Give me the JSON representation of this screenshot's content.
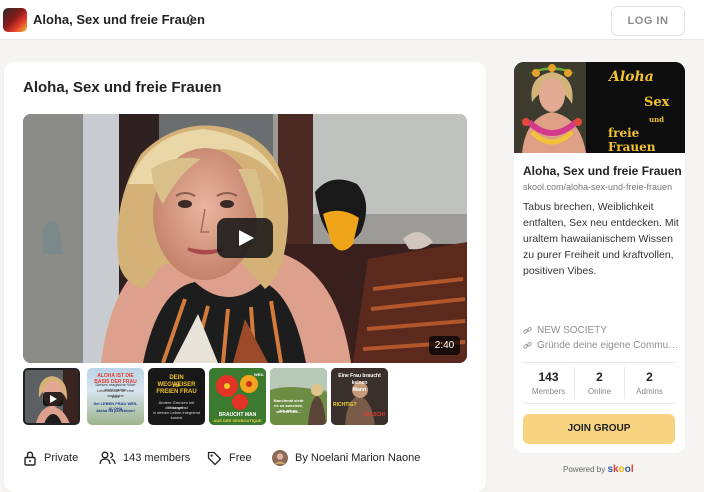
{
  "header": {
    "title": "Aloha, Sex und freie Frauen",
    "login_label": "LOG IN"
  },
  "main": {
    "title": "Aloha, Sex und freie Frauen",
    "video_duration": "2:40",
    "thumbnails": [
      {
        "lines": []
      },
      {
        "lines": [
          "ALOHA IST DIE BASIS DER FRAU",
          "Dieses magische Wort steht meiner",
          "Leidenschaft für eine weibliche",
          "Welt",
          "Sei LEBEN FRAU WEIL ALOHA",
          "Aloha ist perfektion!"
        ]
      },
      {
        "lines": [
          "DEIN WEGWEISER",
          "zur",
          "FREIEN FRAU",
          "Ändere Grenzen mit Übungen",
          "die du selbst",
          "in deinen Leben integrierst kannst"
        ]
      },
      {
        "lines": [
          "BRAUCHT MAN",
          "WEIL",
          "AUS DER SEXBOUTIQUE"
        ]
      },
      {
        "lines": [
          "Manchmal sieht es so aussieht, als wären",
          "wir mit uns..."
        ]
      },
      {
        "lines": [
          "Eine Frau braucht",
          "keinen",
          "Mann",
          "RICHTIG?",
          "FALSCH!"
        ]
      }
    ],
    "meta": {
      "privacy": "Private",
      "members": "143 members",
      "price": "Free",
      "author": "By Noelani Marion Naone"
    }
  },
  "sidebar": {
    "banner_lines": [
      "Aloha",
      "Sex",
      "und",
      "freie Frauen"
    ],
    "name": "Aloha, Sex und freie Frauen",
    "url": "skool.com/aloha-sex-und-freie-frauen",
    "description": "Tabus brechen, Weiblichkeit entfalten, Sex neu entdecken. Mit uraltem hawaiianischem Wissen zu purer Freiheit und kraftvollen, positiven Vibes.",
    "links": [
      "NEW SOCIETY",
      "Gründe deine eigene Commu…"
    ],
    "stats": [
      {
        "value": "143",
        "label": "Members"
      },
      {
        "value": "2",
        "label": "Online"
      },
      {
        "value": "2",
        "label": "Admins"
      }
    ],
    "join_label": "JOIN GROUP"
  },
  "footer": {
    "powered_by": "Powered by",
    "brand": "skool"
  },
  "colors": {
    "join_button": "#f8d481",
    "banner_text": "#f3c22f",
    "skool_letters": [
      "#2e58a6",
      "#e63a30",
      "#f4b400",
      "#2e58a6",
      "#e63a30"
    ]
  }
}
